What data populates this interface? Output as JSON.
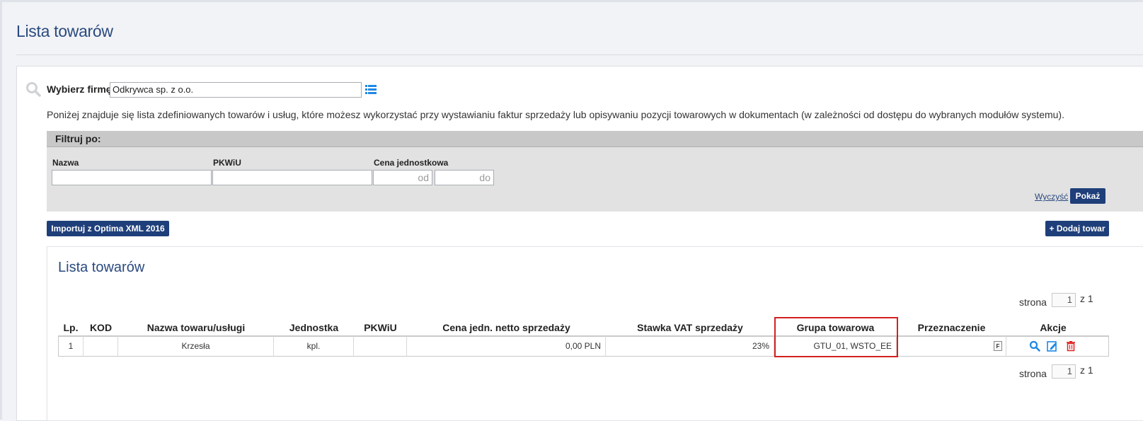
{
  "page": {
    "title": "Lista towarów"
  },
  "company": {
    "label": "Wybierz firmę",
    "value": "Odkrywca sp. z o.o."
  },
  "description": "Poniżej znajduje się lista zdefiniowanych towarów i usług, które możesz wykorzystać przy wystawianiu faktur sprzedaży lub opisywaniu pozycji towarowych w dokumentach (w zależności od dostępu do wybranych modułów systemu).",
  "filter": {
    "title": "Filtruj po:",
    "name_label": "Nazwa",
    "pkwiu_label": "PKWiU",
    "price_label": "Cena jednostkowa",
    "price_from_placeholder": "od",
    "price_to_placeholder": "do",
    "clear_label": "Wyczyść",
    "show_label": "Pokaż"
  },
  "actions": {
    "import_label": "Importuj z Optima XML 2016",
    "add_label": "+ Dodaj towar"
  },
  "list": {
    "title": "Lista towarów",
    "pager_top": {
      "label": "strona",
      "page": "1",
      "of": "z 1"
    },
    "pager_bottom": {
      "label": "strona",
      "page": "1",
      "of": "z 1"
    },
    "columns": [
      "Lp.",
      "KOD",
      "Nazwa towaru/usługi",
      "Jednostka",
      "PKWiU",
      "Cena jedn. netto sprzedaży",
      "Stawka VAT sprzedaży",
      "Grupa towarowa",
      "Przeznaczenie",
      "Akcje"
    ],
    "rows": [
      {
        "lp": "1",
        "kod": "",
        "nazwa": "Krzesła",
        "jednostka": "kpl.",
        "pkwiu": "",
        "cena": "0,00 PLN",
        "vat": "23%",
        "grupa": "GTU_01, WSTO_EE",
        "przeznaczenie": "F"
      }
    ]
  },
  "colors": {
    "brand": "#1f3f7a",
    "title": "#2a4a7f",
    "highlight": "#d32020",
    "delete": "#e02424",
    "icon_blue": "#1e88e5"
  },
  "icons": [
    "search-icon",
    "list-icon",
    "magnifier-icon",
    "edit-icon",
    "trash-icon"
  ]
}
